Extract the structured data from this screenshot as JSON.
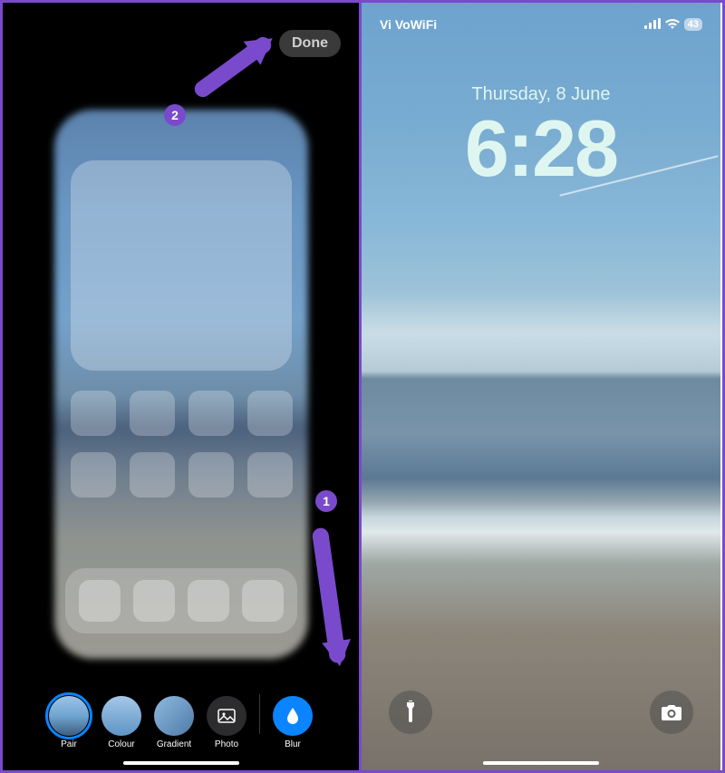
{
  "left": {
    "done_label": "Done",
    "annotation1": "1",
    "annotation2": "2",
    "options": {
      "pair": "Pair",
      "colour": "Colour",
      "gradient": "Gradient",
      "photo": "Photo",
      "blur": "Blur"
    }
  },
  "right": {
    "carrier": "Vi VoWiFi",
    "battery": "43",
    "date": "Thursday, 8 June",
    "time": "6:28"
  },
  "colors": {
    "accent": "#7a4acc",
    "ios_blue": "#0a84ff",
    "clock": "#dff6f0"
  }
}
